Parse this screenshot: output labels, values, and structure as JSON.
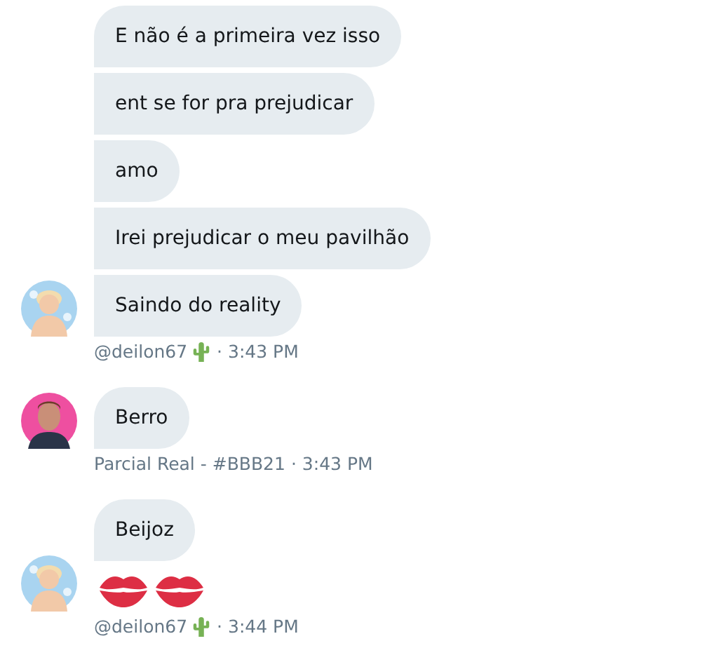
{
  "groups": [
    {
      "avatar": {
        "kind": "cartoon"
      },
      "messages": [
        {
          "kind": "text",
          "text": "E não é a primeira vez isso"
        },
        {
          "kind": "text",
          "text": "ent se for pra prejudicar"
        },
        {
          "kind": "text",
          "text": "amo"
        },
        {
          "kind": "text",
          "text": "Irei prejudicar o meu pavilhão"
        },
        {
          "kind": "text",
          "text": "Saindo do reality"
        }
      ],
      "meta": {
        "author": "@deilon67",
        "badge": true,
        "time": "· 3:43 PM"
      }
    },
    {
      "avatar": {
        "kind": "photo"
      },
      "messages": [
        {
          "kind": "text",
          "text": "Berro"
        }
      ],
      "meta": {
        "author": "Parcial Real - #BBB21",
        "badge": false,
        "time": "· 3:43 PM"
      }
    },
    {
      "avatar": {
        "kind": "cartoon"
      },
      "messages": [
        {
          "kind": "text",
          "text": "Beijoz"
        },
        {
          "kind": "lips"
        }
      ],
      "meta": {
        "author": "@deilon67",
        "badge": true,
        "time": "· 3:44 PM"
      }
    }
  ]
}
